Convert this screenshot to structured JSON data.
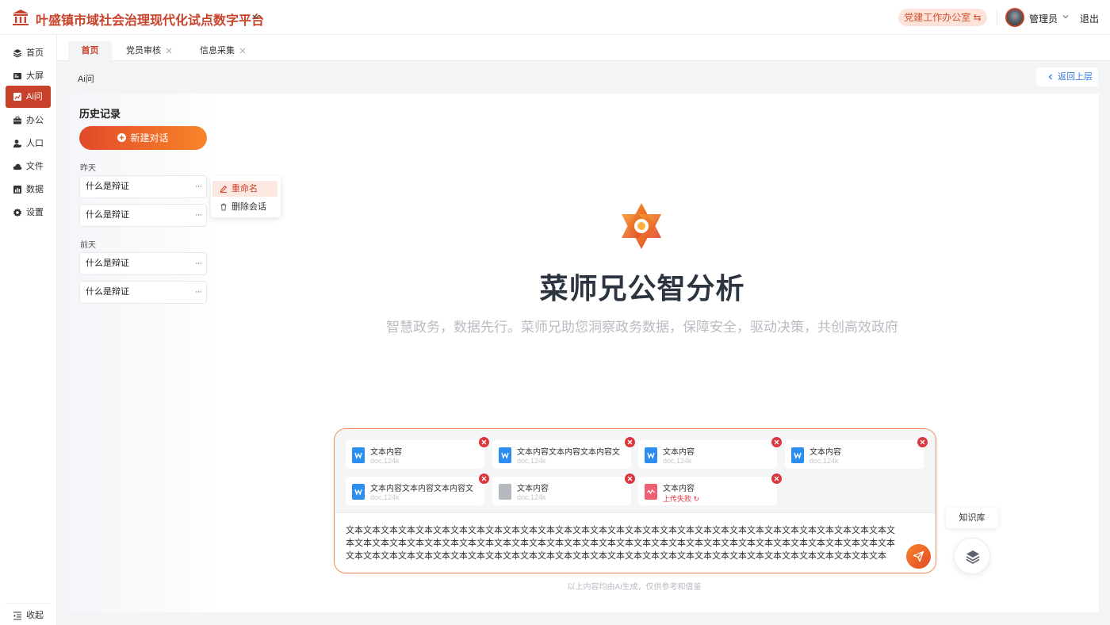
{
  "app": {
    "title": "叶盛镇市域社会治理现代化试点数字平台"
  },
  "header": {
    "office_button": "党建工作办公室 ⇆",
    "user_name": "管理员",
    "logout": "退出"
  },
  "sidebar": {
    "items": [
      {
        "label": "首页",
        "icon": "layers-icon"
      },
      {
        "label": "大屏",
        "icon": "screen-icon"
      },
      {
        "label": "Ai问",
        "icon": "chart-icon",
        "active": true
      },
      {
        "label": "办公",
        "icon": "briefcase-icon"
      },
      {
        "label": "人口",
        "icon": "person-icon"
      },
      {
        "label": "文件",
        "icon": "cloud-icon"
      },
      {
        "label": "数据",
        "icon": "bar-chart-icon"
      },
      {
        "label": "设置",
        "icon": "gear-icon"
      }
    ],
    "collapse_label": "收起"
  },
  "tabs": [
    {
      "label": "首页",
      "active": true
    },
    {
      "label": "党员审核",
      "closable": true
    },
    {
      "label": "信息采集",
      "closable": true
    }
  ],
  "breadcrumb": "Ai问",
  "back_button": "返回上层",
  "history": {
    "title": "历史记录",
    "new_chat": "新建对话",
    "groups": [
      {
        "label": "昨天",
        "items": [
          "什么是辩证",
          "什么是辩证"
        ]
      },
      {
        "label": "前天",
        "items": [
          "什么是辩证",
          "什么是辩证"
        ]
      }
    ],
    "item_more": "···"
  },
  "context_menu": {
    "rename": "重命名",
    "delete": "删除会话"
  },
  "hero": {
    "brand": "菜师兄公智分析",
    "slogan": "智慧政务，数据先行。菜师兄助您洞察政务数据，保障安全，驱动决策，共创高效政府"
  },
  "attachments": [
    {
      "name": "文本内容",
      "meta": "doc,124k",
      "type": "word"
    },
    {
      "name": "文本内容文本内容文本内容文",
      "meta": "doc,124k",
      "type": "word"
    },
    {
      "name": "文本内容",
      "meta": "doc,124k",
      "type": "word"
    },
    {
      "name": "文本内容",
      "meta": "doc,124k",
      "type": "word"
    },
    {
      "name": "文本内容文本内容文本内容文",
      "meta": "doc,124k",
      "type": "word"
    },
    {
      "name": "文本内容",
      "meta": "doc,124k",
      "type": "generic"
    },
    {
      "name": "文本内容",
      "meta": "上传失败 ↻",
      "type": "failed"
    }
  ],
  "input": {
    "text": "文本文本文本文本文本文本文本文本文本文本文本文本文本文本文本文本文本文本文本文本文本文本文本文本文本文本文本文本文本文本文本文本文本文本文本文本文本文本文本文本文本文本文本文本文本文本文本文本文本文本文本文本文本文本文本文本文本文本文本文本文本文本文本文本文本文本文本文本文本文本文本文本文本文本文本文本文本文本文本文本文本文本文本文本文本文本文本文本文本文本文本文本文本文本"
  },
  "knowledge_base": "知识库",
  "disclaimer": "以上内容均由Ai生成，仅供参考和借鉴",
  "colors": {
    "accent": "#c8422b",
    "gradient_start": "#e24a2a",
    "gradient_end": "#f7852a",
    "link": "#3a7be0",
    "error": "#d9363e"
  }
}
